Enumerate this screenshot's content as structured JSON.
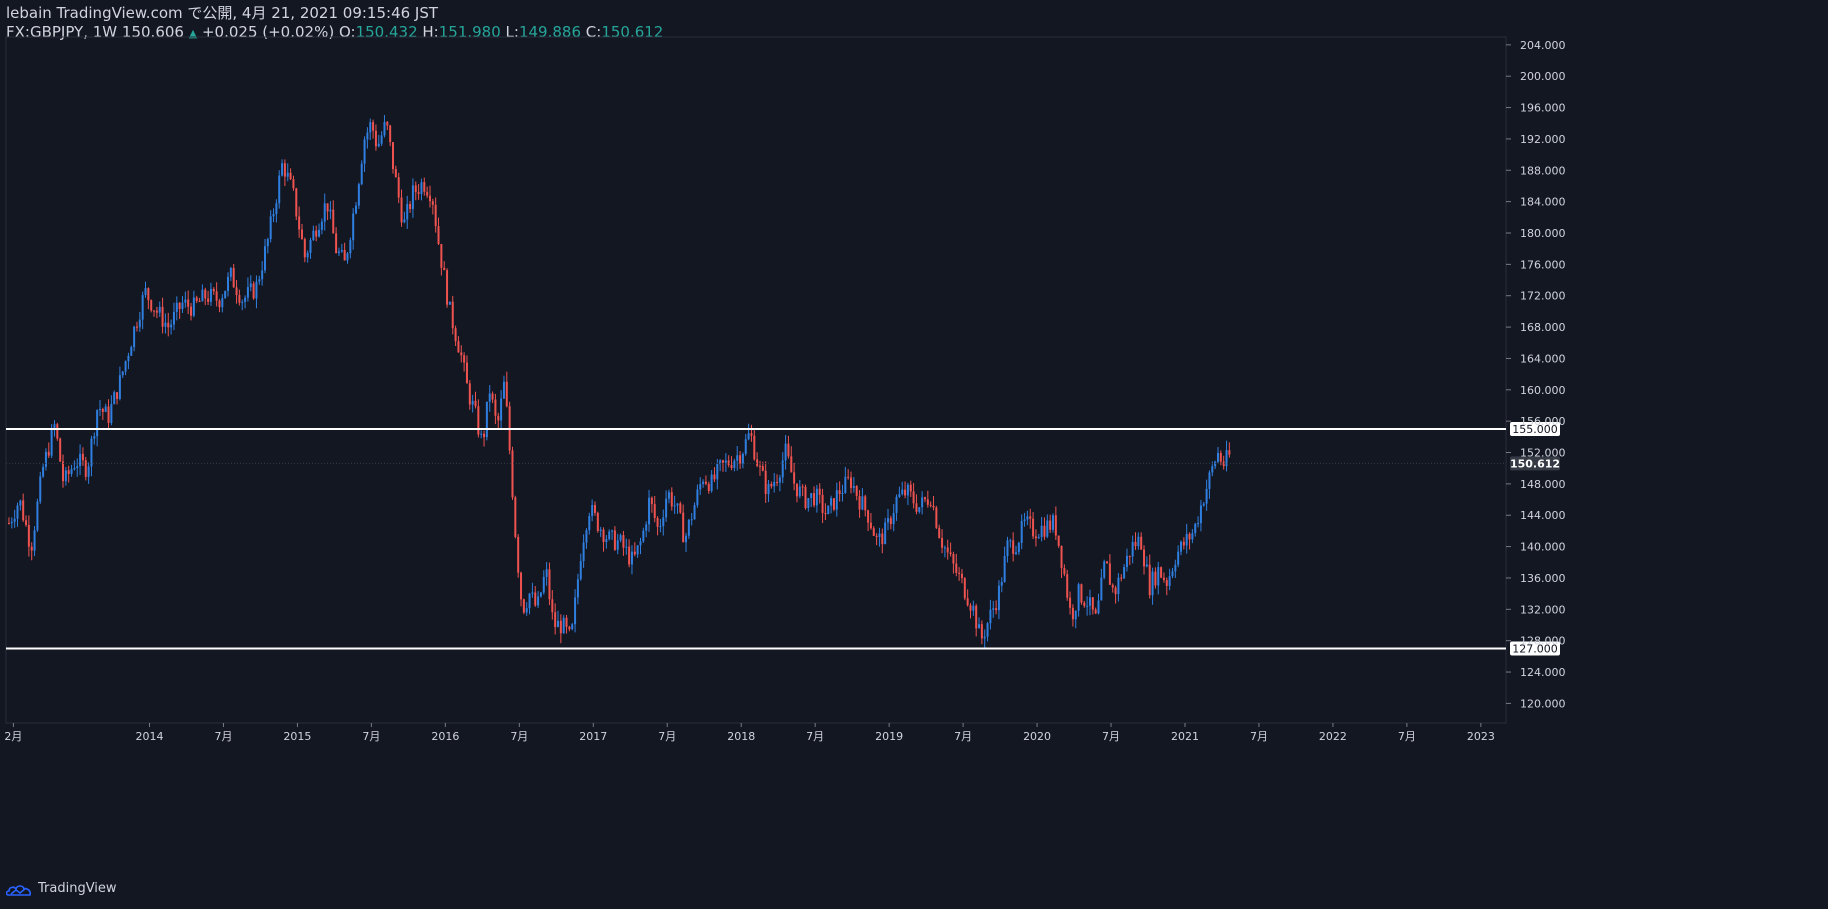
{
  "header": {
    "author_line": "lebain TradingView.com で公開, 4月 21, 2021 09:15:46 JST",
    "symbol": "FX:GBPJPY, 1W",
    "last": "150.606",
    "change": "+0.025 (+0.02%)",
    "o_label": "O:",
    "o_value": "150.432",
    "h_label": "H:",
    "h_value": "151.980",
    "l_label": "L:",
    "l_value": "149.886",
    "c_label": "C:",
    "c_value": "150.612"
  },
  "footer": {
    "brand": "TradingView"
  },
  "colors": {
    "background": "#131722",
    "up": "#2f7fe0",
    "down": "#ef5350",
    "grid": "#1e222d",
    "axis_text": "#d1d4dc",
    "hline": "#ffffff",
    "price_value": "#26a69a"
  },
  "chart_data": {
    "type": "candlestick",
    "symbol": "FX:GBPJPY",
    "interval": "1W",
    "ylim": [
      117.5,
      205.0
    ],
    "y_ticks": [
      "120.000",
      "124.000",
      "128.000",
      "132.000",
      "136.000",
      "140.000",
      "144.000",
      "148.000",
      "152.000",
      "156.000",
      "160.000",
      "164.000",
      "168.000",
      "172.000",
      "176.000",
      "180.000",
      "184.000",
      "188.000",
      "192.000",
      "196.000",
      "200.000",
      "204.000"
    ],
    "x_ticks": [
      {
        "label": "2月",
        "t": 2013.08
      },
      {
        "label": "2014",
        "t": 2014.0
      },
      {
        "label": "7月",
        "t": 2014.5
      },
      {
        "label": "2015",
        "t": 2015.0
      },
      {
        "label": "7月",
        "t": 2015.5
      },
      {
        "label": "2016",
        "t": 2016.0
      },
      {
        "label": "7月",
        "t": 2016.5
      },
      {
        "label": "2017",
        "t": 2017.0
      },
      {
        "label": "7月",
        "t": 2017.5
      },
      {
        "label": "2018",
        "t": 2018.0
      },
      {
        "label": "7月",
        "t": 2018.5
      },
      {
        "label": "2019",
        "t": 2019.0
      },
      {
        "label": "7月",
        "t": 2019.5
      },
      {
        "label": "2020",
        "t": 2020.0
      },
      {
        "label": "7月",
        "t": 2020.5
      },
      {
        "label": "2021",
        "t": 2021.0
      },
      {
        "label": "7月",
        "t": 2021.5
      },
      {
        "label": "2022",
        "t": 2022.0
      },
      {
        "label": "7月",
        "t": 2022.5
      },
      {
        "label": "2023",
        "t": 2023.0
      }
    ],
    "horizontal_lines": [
      {
        "price": 155.0,
        "label": "155.000"
      },
      {
        "price": 127.0,
        "label": "127.000"
      }
    ],
    "current_price": {
      "price": 150.612,
      "label": "150.612"
    },
    "trend_close": [
      [
        2013.05,
        143.0
      ],
      [
        2013.12,
        146.0
      ],
      [
        2013.2,
        140.0
      ],
      [
        2013.28,
        150.0
      ],
      [
        2013.36,
        155.5
      ],
      [
        2013.42,
        148.0
      ],
      [
        2013.5,
        151.0
      ],
      [
        2013.58,
        150.0
      ],
      [
        2013.65,
        158.0
      ],
      [
        2013.72,
        156.5
      ],
      [
        2013.8,
        161.0
      ],
      [
        2013.9,
        168.0
      ],
      [
        2013.97,
        172.5
      ],
      [
        2014.05,
        170.0
      ],
      [
        2014.13,
        168.0
      ],
      [
        2014.22,
        171.0
      ],
      [
        2014.3,
        170.5
      ],
      [
        2014.38,
        172.0
      ],
      [
        2014.47,
        171.5
      ],
      [
        2014.55,
        174.5
      ],
      [
        2014.63,
        171.5
      ],
      [
        2014.72,
        173.0
      ],
      [
        2014.8,
        179.0
      ],
      [
        2014.9,
        189.0
      ],
      [
        2014.97,
        185.0
      ],
      [
        2015.05,
        177.0
      ],
      [
        2015.13,
        181.0
      ],
      [
        2015.2,
        184.0
      ],
      [
        2015.26,
        178.0
      ],
      [
        2015.32,
        176.0
      ],
      [
        2015.4,
        185.0
      ],
      [
        2015.45,
        192.0
      ],
      [
        2015.5,
        194.0
      ],
      [
        2015.54,
        191.0
      ],
      [
        2015.6,
        194.0
      ],
      [
        2015.67,
        186.0
      ],
      [
        2015.72,
        181.0
      ],
      [
        2015.78,
        185.0
      ],
      [
        2015.85,
        186.5
      ],
      [
        2015.91,
        185.0
      ],
      [
        2015.96,
        178.0
      ],
      [
        2016.03,
        170.0
      ],
      [
        2016.1,
        165.0
      ],
      [
        2016.15,
        160.0
      ],
      [
        2016.2,
        157.0
      ],
      [
        2016.25,
        153.0
      ],
      [
        2016.3,
        160.0
      ],
      [
        2016.35,
        155.0
      ],
      [
        2016.4,
        161.0
      ],
      [
        2016.44,
        151.0
      ],
      [
        2016.48,
        140.0
      ],
      [
        2016.52,
        132.0
      ],
      [
        2016.57,
        134.0
      ],
      [
        2016.62,
        132.0
      ],
      [
        2016.68,
        137.0
      ],
      [
        2016.73,
        130.0
      ],
      [
        2016.79,
        130.0
      ],
      [
        2016.85,
        128.0
      ],
      [
        2016.92,
        140.0
      ],
      [
        2016.97,
        145.0
      ],
      [
        2017.03,
        143.0
      ],
      [
        2017.1,
        141.0
      ],
      [
        2017.18,
        140.5
      ],
      [
        2017.27,
        138.0
      ],
      [
        2017.33,
        141.0
      ],
      [
        2017.38,
        146.0
      ],
      [
        2017.44,
        142.0
      ],
      [
        2017.5,
        147.0
      ],
      [
        2017.56,
        145.0
      ],
      [
        2017.62,
        141.0
      ],
      [
        2017.68,
        145.0
      ],
      [
        2017.74,
        149.0
      ],
      [
        2017.8,
        148.0
      ],
      [
        2017.86,
        150.0
      ],
      [
        2017.93,
        151.0
      ],
      [
        2018.0,
        152.0
      ],
      [
        2018.06,
        154.5
      ],
      [
        2018.12,
        150.0
      ],
      [
        2018.18,
        147.0
      ],
      [
        2018.24,
        149.0
      ],
      [
        2018.3,
        152.0
      ],
      [
        2018.36,
        148.0
      ],
      [
        2018.43,
        146.0
      ],
      [
        2018.5,
        146.5
      ],
      [
        2018.58,
        144.0
      ],
      [
        2018.66,
        147.0
      ],
      [
        2018.74,
        148.5
      ],
      [
        2018.8,
        146.0
      ],
      [
        2018.86,
        144.0
      ],
      [
        2018.92,
        140.5
      ],
      [
        2018.98,
        142.0
      ],
      [
        2019.05,
        146.0
      ],
      [
        2019.12,
        147.0
      ],
      [
        2019.2,
        145.0
      ],
      [
        2019.28,
        146.5
      ],
      [
        2019.35,
        141.0
      ],
      [
        2019.42,
        138.0
      ],
      [
        2019.5,
        135.0
      ],
      [
        2019.57,
        132.0
      ],
      [
        2019.62,
        128.0
      ],
      [
        2019.68,
        131.0
      ],
      [
        2019.74,
        134.0
      ],
      [
        2019.8,
        140.0
      ],
      [
        2019.86,
        140.5
      ],
      [
        2019.92,
        143.0
      ],
      [
        2019.98,
        142.0
      ],
      [
        2020.05,
        142.5
      ],
      [
        2020.12,
        143.0
      ],
      [
        2020.18,
        137.0
      ],
      [
        2020.23,
        131.0
      ],
      [
        2020.28,
        134.0
      ],
      [
        2020.34,
        133.0
      ],
      [
        2020.4,
        130.5
      ],
      [
        2020.46,
        138.0
      ],
      [
        2020.52,
        134.0
      ],
      [
        2020.58,
        137.0
      ],
      [
        2020.64,
        140.0
      ],
      [
        2020.7,
        141.0
      ],
      [
        2020.76,
        135.0
      ],
      [
        2020.82,
        137.0
      ],
      [
        2020.88,
        135.5
      ],
      [
        2020.94,
        139.0
      ],
      [
        2021.0,
        140.5
      ],
      [
        2021.06,
        142.0
      ],
      [
        2021.12,
        146.0
      ],
      [
        2021.17,
        149.0
      ],
      [
        2021.22,
        152.0
      ],
      [
        2021.26,
        150.5
      ],
      [
        2021.3,
        151.5
      ]
    ]
  }
}
